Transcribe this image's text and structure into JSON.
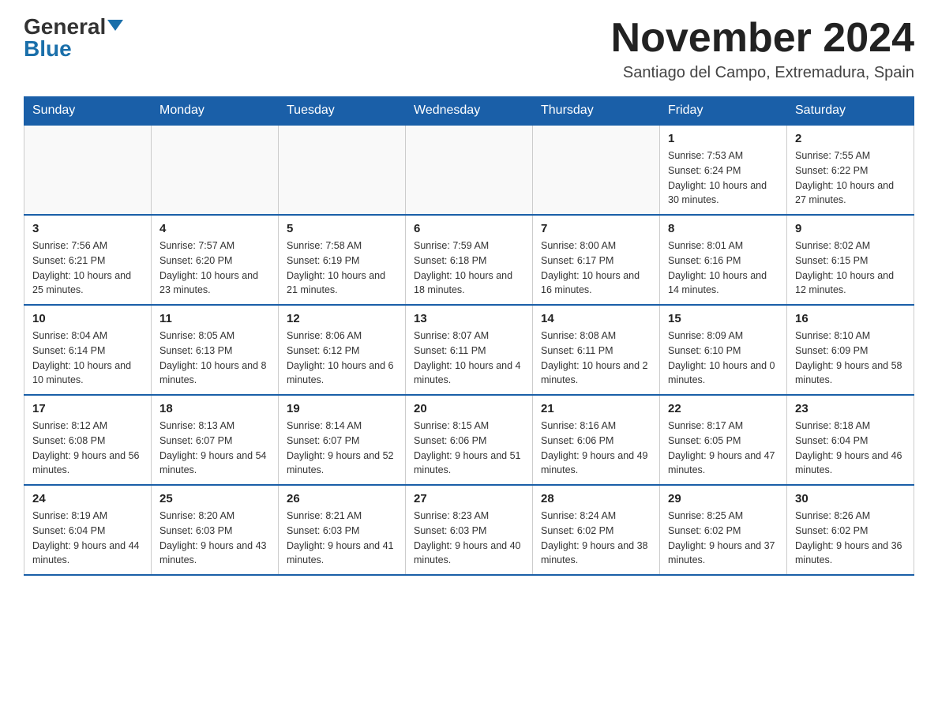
{
  "header": {
    "logo_general": "General",
    "logo_blue": "Blue",
    "month_title": "November 2024",
    "location": "Santiago del Campo, Extremadura, Spain"
  },
  "weekdays": [
    "Sunday",
    "Monday",
    "Tuesday",
    "Wednesday",
    "Thursday",
    "Friday",
    "Saturday"
  ],
  "weeks": [
    [
      {
        "day": "",
        "info": ""
      },
      {
        "day": "",
        "info": ""
      },
      {
        "day": "",
        "info": ""
      },
      {
        "day": "",
        "info": ""
      },
      {
        "day": "",
        "info": ""
      },
      {
        "day": "1",
        "info": "Sunrise: 7:53 AM\nSunset: 6:24 PM\nDaylight: 10 hours and 30 minutes."
      },
      {
        "day": "2",
        "info": "Sunrise: 7:55 AM\nSunset: 6:22 PM\nDaylight: 10 hours and 27 minutes."
      }
    ],
    [
      {
        "day": "3",
        "info": "Sunrise: 7:56 AM\nSunset: 6:21 PM\nDaylight: 10 hours and 25 minutes."
      },
      {
        "day": "4",
        "info": "Sunrise: 7:57 AM\nSunset: 6:20 PM\nDaylight: 10 hours and 23 minutes."
      },
      {
        "day": "5",
        "info": "Sunrise: 7:58 AM\nSunset: 6:19 PM\nDaylight: 10 hours and 21 minutes."
      },
      {
        "day": "6",
        "info": "Sunrise: 7:59 AM\nSunset: 6:18 PM\nDaylight: 10 hours and 18 minutes."
      },
      {
        "day": "7",
        "info": "Sunrise: 8:00 AM\nSunset: 6:17 PM\nDaylight: 10 hours and 16 minutes."
      },
      {
        "day": "8",
        "info": "Sunrise: 8:01 AM\nSunset: 6:16 PM\nDaylight: 10 hours and 14 minutes."
      },
      {
        "day": "9",
        "info": "Sunrise: 8:02 AM\nSunset: 6:15 PM\nDaylight: 10 hours and 12 minutes."
      }
    ],
    [
      {
        "day": "10",
        "info": "Sunrise: 8:04 AM\nSunset: 6:14 PM\nDaylight: 10 hours and 10 minutes."
      },
      {
        "day": "11",
        "info": "Sunrise: 8:05 AM\nSunset: 6:13 PM\nDaylight: 10 hours and 8 minutes."
      },
      {
        "day": "12",
        "info": "Sunrise: 8:06 AM\nSunset: 6:12 PM\nDaylight: 10 hours and 6 minutes."
      },
      {
        "day": "13",
        "info": "Sunrise: 8:07 AM\nSunset: 6:11 PM\nDaylight: 10 hours and 4 minutes."
      },
      {
        "day": "14",
        "info": "Sunrise: 8:08 AM\nSunset: 6:11 PM\nDaylight: 10 hours and 2 minutes."
      },
      {
        "day": "15",
        "info": "Sunrise: 8:09 AM\nSunset: 6:10 PM\nDaylight: 10 hours and 0 minutes."
      },
      {
        "day": "16",
        "info": "Sunrise: 8:10 AM\nSunset: 6:09 PM\nDaylight: 9 hours and 58 minutes."
      }
    ],
    [
      {
        "day": "17",
        "info": "Sunrise: 8:12 AM\nSunset: 6:08 PM\nDaylight: 9 hours and 56 minutes."
      },
      {
        "day": "18",
        "info": "Sunrise: 8:13 AM\nSunset: 6:07 PM\nDaylight: 9 hours and 54 minutes."
      },
      {
        "day": "19",
        "info": "Sunrise: 8:14 AM\nSunset: 6:07 PM\nDaylight: 9 hours and 52 minutes."
      },
      {
        "day": "20",
        "info": "Sunrise: 8:15 AM\nSunset: 6:06 PM\nDaylight: 9 hours and 51 minutes."
      },
      {
        "day": "21",
        "info": "Sunrise: 8:16 AM\nSunset: 6:06 PM\nDaylight: 9 hours and 49 minutes."
      },
      {
        "day": "22",
        "info": "Sunrise: 8:17 AM\nSunset: 6:05 PM\nDaylight: 9 hours and 47 minutes."
      },
      {
        "day": "23",
        "info": "Sunrise: 8:18 AM\nSunset: 6:04 PM\nDaylight: 9 hours and 46 minutes."
      }
    ],
    [
      {
        "day": "24",
        "info": "Sunrise: 8:19 AM\nSunset: 6:04 PM\nDaylight: 9 hours and 44 minutes."
      },
      {
        "day": "25",
        "info": "Sunrise: 8:20 AM\nSunset: 6:03 PM\nDaylight: 9 hours and 43 minutes."
      },
      {
        "day": "26",
        "info": "Sunrise: 8:21 AM\nSunset: 6:03 PM\nDaylight: 9 hours and 41 minutes."
      },
      {
        "day": "27",
        "info": "Sunrise: 8:23 AM\nSunset: 6:03 PM\nDaylight: 9 hours and 40 minutes."
      },
      {
        "day": "28",
        "info": "Sunrise: 8:24 AM\nSunset: 6:02 PM\nDaylight: 9 hours and 38 minutes."
      },
      {
        "day": "29",
        "info": "Sunrise: 8:25 AM\nSunset: 6:02 PM\nDaylight: 9 hours and 37 minutes."
      },
      {
        "day": "30",
        "info": "Sunrise: 8:26 AM\nSunset: 6:02 PM\nDaylight: 9 hours and 36 minutes."
      }
    ]
  ]
}
